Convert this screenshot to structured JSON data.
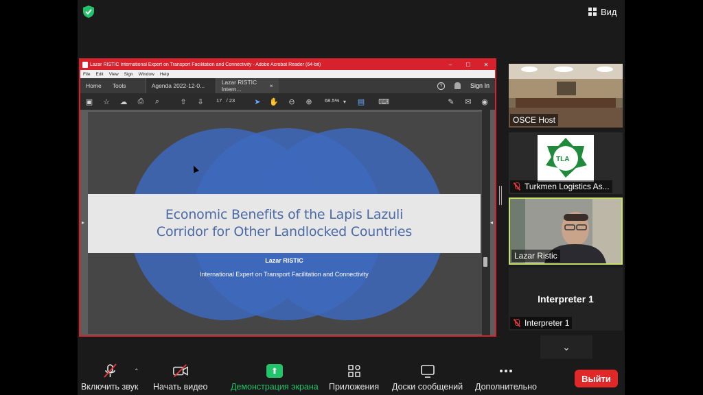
{
  "view_button": {
    "label": "Вид"
  },
  "acrobat": {
    "title": "Lazar RISTIC International Expert on Transport Facilitation and Connectivity - Adobe Acrobat Reader (64-bit)",
    "window_controls": [
      "–",
      "☐",
      "✕"
    ],
    "menu": [
      "File",
      "Edit",
      "View",
      "Sign",
      "Window",
      "Help"
    ],
    "tabs": {
      "home": "Home",
      "tools": "Tools",
      "doc1": "Agenda 2022-12-0...",
      "doc2": "Lazar RISTIC Intern...",
      "doc2_close": "×",
      "sign_in": "Sign In"
    },
    "toolbar": {
      "page_current": "17",
      "page_total": "/ 23",
      "zoom": "68.5%"
    }
  },
  "slide": {
    "title_line1": "Economic Benefits of the Lapis Lazuli",
    "title_line2": "Corridor for Other Landlocked Countries",
    "presenter": "Lazar RISTIC",
    "role": "International Expert on Transport Facilitation and Connectivity"
  },
  "participants": [
    {
      "name": "OSCE Host",
      "muted": false
    },
    {
      "name": "Turkmen Logistics As...",
      "muted": true,
      "logo_text": "TLA"
    },
    {
      "name": "Lazar Ristic",
      "muted": false,
      "active_speaker": true
    },
    {
      "name": "Interpreter 1",
      "muted": true,
      "display_name": "Interpreter 1"
    }
  ],
  "toolbar": {
    "unmute": "Включить звук",
    "start_video": "Начать видео",
    "share_screen": "Демонстрация экрана",
    "apps": "Приложения",
    "whiteboards": "Доски сообщений",
    "more": "Дополнительно",
    "leave": "Выйти"
  },
  "colors": {
    "acrobat_red": "#d7212c",
    "zoom_green": "#23c36b",
    "leave_red": "#e02828",
    "active_speaker_border": "#c8e06a",
    "slide_blue": "#3e68bc"
  }
}
